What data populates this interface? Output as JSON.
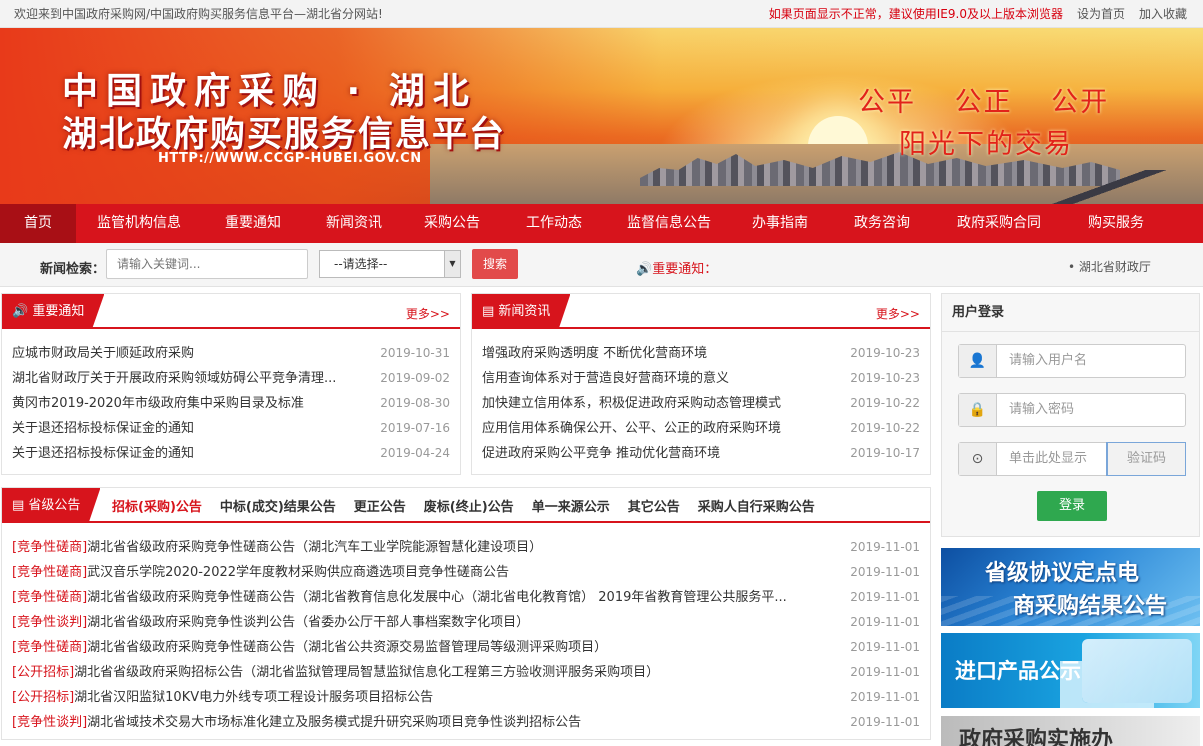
{
  "topbar": {
    "welcome": "欢迎来到中国政府采购网/中国政府购买服务信息平台—湖北省分网站!",
    "browser_warning": "如果页面显示不正常，建议使用IE9.0及以上版本浏览器",
    "set_home": "设为首页",
    "add_favorite": "加入收藏"
  },
  "banner": {
    "title_line1": "中国政府采购 · 湖北",
    "title_line2": "湖北政府购买服务信息平台",
    "url": "HTTP://WWW.CCGP-HUBEI.GOV.CN",
    "slogan_line1": "公平 公正 公开",
    "slogan_line2": "阳光下的交易"
  },
  "nav": {
    "items": [
      "首页",
      "监管机构信息",
      "重要通知",
      "新闻资讯",
      "采购公告",
      "工作动态",
      "监督信息公告",
      "办事指南",
      "政务咨询",
      "政府采购合同",
      "购买服务"
    ]
  },
  "search": {
    "label": "新闻检索：",
    "placeholder": "请输入关键词...",
    "select_value": "--请选择--",
    "button": "搜索",
    "notice_label": "重要通知：",
    "marquee_text": "• 湖北省财政厅"
  },
  "important_notice": {
    "title": "重要通知",
    "more": "更多>>",
    "items": [
      {
        "title": "应城市财政局关于顺延政府采购",
        "date": "2019-10-31"
      },
      {
        "title": "湖北省财政厅关于开展政府采购领域妨碍公平竞争清理...",
        "date": "2019-09-02"
      },
      {
        "title": "黄冈市2019-2020年市级政府集中采购目录及标准",
        "date": "2019-08-30"
      },
      {
        "title": "关于退还招标投标保证金的通知",
        "date": "2019-07-16"
      },
      {
        "title": "关于退还招标投标保证金的通知",
        "date": "2019-04-24"
      }
    ]
  },
  "news": {
    "title": "新闻资讯",
    "more": "更多>>",
    "items": [
      {
        "title": "增强政府采购透明度 不断优化营商环境",
        "date": "2019-10-23"
      },
      {
        "title": "信用查询体系对于营造良好营商环境的意义",
        "date": "2019-10-23"
      },
      {
        "title": "加快建立信用体系，积极促进政府采购动态管理模式",
        "date": "2019-10-22"
      },
      {
        "title": "应用信用体系确保公开、公平、公正的政府采购环境",
        "date": "2019-10-22"
      },
      {
        "title": "促进政府采购公平竞争 推动优化营商环境",
        "date": "2019-10-17"
      }
    ]
  },
  "provincial": {
    "title": "省级公告",
    "tabs": [
      "招标(采购)公告",
      "中标(成交)结果公告",
      "更正公告",
      "废标(终止)公告",
      "单一来源公示",
      "其它公告",
      "采购人自行采购公告"
    ],
    "items": [
      {
        "tag": "[竞争性磋商]",
        "title": "湖北省省级政府采购竞争性磋商公告（湖北汽车工业学院能源智慧化建设项目）",
        "date": "2019-11-01"
      },
      {
        "tag": "[竞争性磋商]",
        "title": "武汉音乐学院2020-2022学年度教材采购供应商遴选项目竞争性磋商公告",
        "date": "2019-11-01"
      },
      {
        "tag": "[竞争性磋商]",
        "title": "湖北省省级政府采购竞争性磋商公告（湖北省教育信息化发展中心（湖北省电化教育馆） 2019年省教育管理公共服务平...",
        "date": "2019-11-01"
      },
      {
        "tag": "[竞争性谈判]",
        "title": "湖北省省级政府采购竞争性谈判公告（省委办公厅干部人事档案数字化项目）",
        "date": "2019-11-01"
      },
      {
        "tag": "[竞争性磋商]",
        "title": "湖北省省级政府采购竞争性磋商公告（湖北省公共资源交易监督管理局等级测评采购项目）",
        "date": "2019-11-01"
      },
      {
        "tag": "[公开招标]",
        "title": "湖北省省级政府采购招标公告（湖北省监狱管理局智慧监狱信息化工程第三方验收测评服务采购项目）",
        "date": "2019-11-01"
      },
      {
        "tag": "[公开招标]",
        "title": "湖北省汉阳监狱10KV电力外线专项工程设计服务项目招标公告",
        "date": "2019-11-01"
      },
      {
        "tag": "[竞争性谈判]",
        "title": "湖北省域技术交易大市场标准化建立及服务模式提升研究采购项目竞争性谈判招标公告",
        "date": "2019-11-01"
      }
    ]
  },
  "login": {
    "title": "用户登录",
    "username_placeholder": "请输入用户名",
    "password_placeholder": "请输入密码",
    "captcha_hint": "单击此处显示",
    "captcha_placeholder": "验证码",
    "button": "登录"
  },
  "promos": {
    "p1_line1": "省级协议定点电",
    "p1_line2": "商采购结果公告",
    "p2": "进口产品公示",
    "p3": "政府采购实施办"
  },
  "colors": {
    "brand_red": "#d7141c",
    "login_green": "#2fa84f"
  }
}
